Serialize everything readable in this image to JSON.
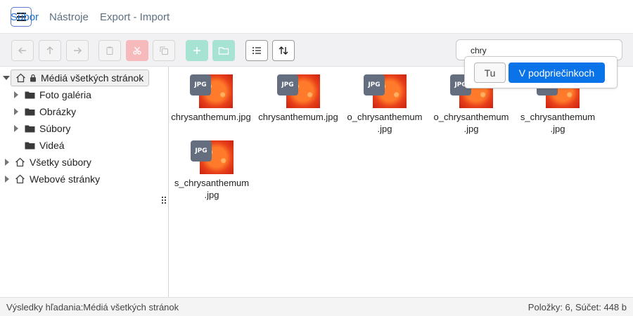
{
  "menu": {
    "items": [
      {
        "label": "Súbor",
        "active": true
      },
      {
        "label": "Nástroje",
        "active": false
      },
      {
        "label": "Export - Import",
        "active": false
      }
    ]
  },
  "toolbar": {
    "buttons": [
      "back-icon",
      "up-icon",
      "forward-icon",
      "paste-icon",
      "cut-icon",
      "copy-icon",
      "add-icon",
      "new-folder-icon",
      "list-view-icon",
      "sort-icon"
    ],
    "search_value": "chry"
  },
  "search_scope": {
    "here_label": "Tu",
    "subfolders_label": "V podpriečinkoch"
  },
  "tree": {
    "root": "Médiá všetkých stránok",
    "children": [
      "Foto galéria",
      "Obrázky",
      "Súbory",
      "Videá"
    ],
    "others": [
      "Všetky súbory",
      "Webové stránky"
    ]
  },
  "files": [
    {
      "name": "chrysanthemum.jpg",
      "badge": "JPG"
    },
    {
      "name": "chrysanthemum.jpg",
      "badge": "JPG"
    },
    {
      "name": "o_chrysanthemum.jpg",
      "badge": "JPG"
    },
    {
      "name": "o_chrysanthemum.jpg",
      "badge": "JPG"
    },
    {
      "name": "s_chrysanthemum.jpg",
      "badge": "JPG"
    },
    {
      "name": "s_chrysanthemum.jpg",
      "badge": "JPG"
    }
  ],
  "file_name_lines": [
    [
      "chrysanthemum.jpg"
    ],
    [
      "chrysanthemum.jpg"
    ],
    [
      "o_chrysanthemum",
      ".jpg"
    ],
    [
      "o_chrysanthemum",
      ".jpg"
    ],
    [
      "s_chrysanthemum",
      ".jpg"
    ],
    [
      "s_chrysanthemum",
      ".jpg"
    ]
  ],
  "status": {
    "left": "Výsledky hľadania:Médiá všetkých stránok",
    "right": "Položky: 6, Súčet: 448 b"
  },
  "colors": {
    "accent": "#0a73e8",
    "menu_active": "#1a6fd1",
    "cut_button": "#f6b9bc",
    "add_button": "#a7e3d3"
  }
}
